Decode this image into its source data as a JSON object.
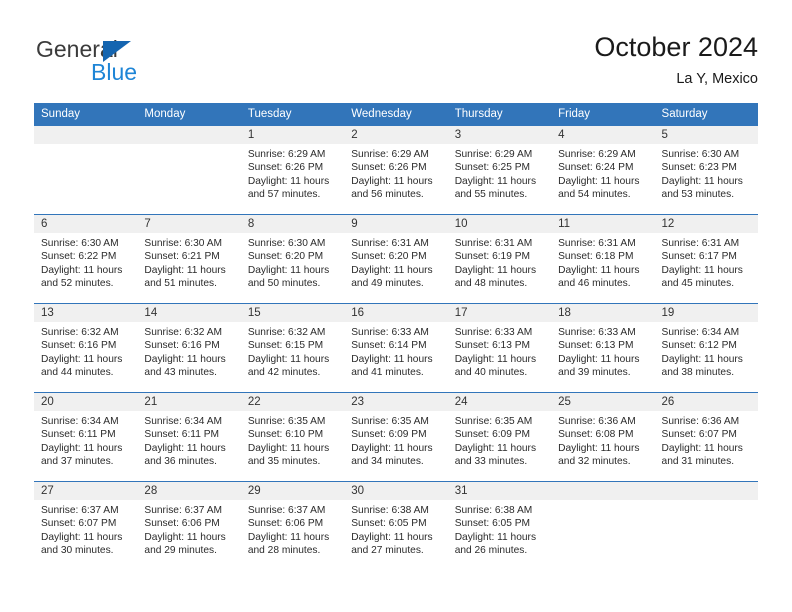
{
  "brand": {
    "name_part1": "General",
    "name_part2": "Blue",
    "triangle_icon": "blue-triangle-icon",
    "colors": {
      "dark": "#3b3b3b",
      "blue": "#1e85d6",
      "triangle": "#1565b0"
    }
  },
  "header": {
    "title": "October 2024",
    "subtitle": "La Y, Mexico"
  },
  "theme": {
    "header_blue": "#3275ba",
    "daynum_band": "#f0f0f0",
    "text": "#2b2b2b"
  },
  "weekday_headers": [
    "Sunday",
    "Monday",
    "Tuesday",
    "Wednesday",
    "Thursday",
    "Friday",
    "Saturday"
  ],
  "weeks": [
    [
      {
        "day": "",
        "lines": []
      },
      {
        "day": "",
        "lines": []
      },
      {
        "day": "1",
        "lines": [
          "Sunrise: 6:29 AM",
          "Sunset: 6:26 PM",
          "Daylight: 11 hours",
          "and 57 minutes."
        ]
      },
      {
        "day": "2",
        "lines": [
          "Sunrise: 6:29 AM",
          "Sunset: 6:26 PM",
          "Daylight: 11 hours",
          "and 56 minutes."
        ]
      },
      {
        "day": "3",
        "lines": [
          "Sunrise: 6:29 AM",
          "Sunset: 6:25 PM",
          "Daylight: 11 hours",
          "and 55 minutes."
        ]
      },
      {
        "day": "4",
        "lines": [
          "Sunrise: 6:29 AM",
          "Sunset: 6:24 PM",
          "Daylight: 11 hours",
          "and 54 minutes."
        ]
      },
      {
        "day": "5",
        "lines": [
          "Sunrise: 6:30 AM",
          "Sunset: 6:23 PM",
          "Daylight: 11 hours",
          "and 53 minutes."
        ]
      }
    ],
    [
      {
        "day": "6",
        "lines": [
          "Sunrise: 6:30 AM",
          "Sunset: 6:22 PM",
          "Daylight: 11 hours",
          "and 52 minutes."
        ]
      },
      {
        "day": "7",
        "lines": [
          "Sunrise: 6:30 AM",
          "Sunset: 6:21 PM",
          "Daylight: 11 hours",
          "and 51 minutes."
        ]
      },
      {
        "day": "8",
        "lines": [
          "Sunrise: 6:30 AM",
          "Sunset: 6:20 PM",
          "Daylight: 11 hours",
          "and 50 minutes."
        ]
      },
      {
        "day": "9",
        "lines": [
          "Sunrise: 6:31 AM",
          "Sunset: 6:20 PM",
          "Daylight: 11 hours",
          "and 49 minutes."
        ]
      },
      {
        "day": "10",
        "lines": [
          "Sunrise: 6:31 AM",
          "Sunset: 6:19 PM",
          "Daylight: 11 hours",
          "and 48 minutes."
        ]
      },
      {
        "day": "11",
        "lines": [
          "Sunrise: 6:31 AM",
          "Sunset: 6:18 PM",
          "Daylight: 11 hours",
          "and 46 minutes."
        ]
      },
      {
        "day": "12",
        "lines": [
          "Sunrise: 6:31 AM",
          "Sunset: 6:17 PM",
          "Daylight: 11 hours",
          "and 45 minutes."
        ]
      }
    ],
    [
      {
        "day": "13",
        "lines": [
          "Sunrise: 6:32 AM",
          "Sunset: 6:16 PM",
          "Daylight: 11 hours",
          "and 44 minutes."
        ]
      },
      {
        "day": "14",
        "lines": [
          "Sunrise: 6:32 AM",
          "Sunset: 6:16 PM",
          "Daylight: 11 hours",
          "and 43 minutes."
        ]
      },
      {
        "day": "15",
        "lines": [
          "Sunrise: 6:32 AM",
          "Sunset: 6:15 PM",
          "Daylight: 11 hours",
          "and 42 minutes."
        ]
      },
      {
        "day": "16",
        "lines": [
          "Sunrise: 6:33 AM",
          "Sunset: 6:14 PM",
          "Daylight: 11 hours",
          "and 41 minutes."
        ]
      },
      {
        "day": "17",
        "lines": [
          "Sunrise: 6:33 AM",
          "Sunset: 6:13 PM",
          "Daylight: 11 hours",
          "and 40 minutes."
        ]
      },
      {
        "day": "18",
        "lines": [
          "Sunrise: 6:33 AM",
          "Sunset: 6:13 PM",
          "Daylight: 11 hours",
          "and 39 minutes."
        ]
      },
      {
        "day": "19",
        "lines": [
          "Sunrise: 6:34 AM",
          "Sunset: 6:12 PM",
          "Daylight: 11 hours",
          "and 38 minutes."
        ]
      }
    ],
    [
      {
        "day": "20",
        "lines": [
          "Sunrise: 6:34 AM",
          "Sunset: 6:11 PM",
          "Daylight: 11 hours",
          "and 37 minutes."
        ]
      },
      {
        "day": "21",
        "lines": [
          "Sunrise: 6:34 AM",
          "Sunset: 6:11 PM",
          "Daylight: 11 hours",
          "and 36 minutes."
        ]
      },
      {
        "day": "22",
        "lines": [
          "Sunrise: 6:35 AM",
          "Sunset: 6:10 PM",
          "Daylight: 11 hours",
          "and 35 minutes."
        ]
      },
      {
        "day": "23",
        "lines": [
          "Sunrise: 6:35 AM",
          "Sunset: 6:09 PM",
          "Daylight: 11 hours",
          "and 34 minutes."
        ]
      },
      {
        "day": "24",
        "lines": [
          "Sunrise: 6:35 AM",
          "Sunset: 6:09 PM",
          "Daylight: 11 hours",
          "and 33 minutes."
        ]
      },
      {
        "day": "25",
        "lines": [
          "Sunrise: 6:36 AM",
          "Sunset: 6:08 PM",
          "Daylight: 11 hours",
          "and 32 minutes."
        ]
      },
      {
        "day": "26",
        "lines": [
          "Sunrise: 6:36 AM",
          "Sunset: 6:07 PM",
          "Daylight: 11 hours",
          "and 31 minutes."
        ]
      }
    ],
    [
      {
        "day": "27",
        "lines": [
          "Sunrise: 6:37 AM",
          "Sunset: 6:07 PM",
          "Daylight: 11 hours",
          "and 30 minutes."
        ]
      },
      {
        "day": "28",
        "lines": [
          "Sunrise: 6:37 AM",
          "Sunset: 6:06 PM",
          "Daylight: 11 hours",
          "and 29 minutes."
        ]
      },
      {
        "day": "29",
        "lines": [
          "Sunrise: 6:37 AM",
          "Sunset: 6:06 PM",
          "Daylight: 11 hours",
          "and 28 minutes."
        ]
      },
      {
        "day": "30",
        "lines": [
          "Sunrise: 6:38 AM",
          "Sunset: 6:05 PM",
          "Daylight: 11 hours",
          "and 27 minutes."
        ]
      },
      {
        "day": "31",
        "lines": [
          "Sunrise: 6:38 AM",
          "Sunset: 6:05 PM",
          "Daylight: 11 hours",
          "and 26 minutes."
        ]
      },
      {
        "day": "",
        "lines": []
      },
      {
        "day": "",
        "lines": []
      }
    ]
  ]
}
